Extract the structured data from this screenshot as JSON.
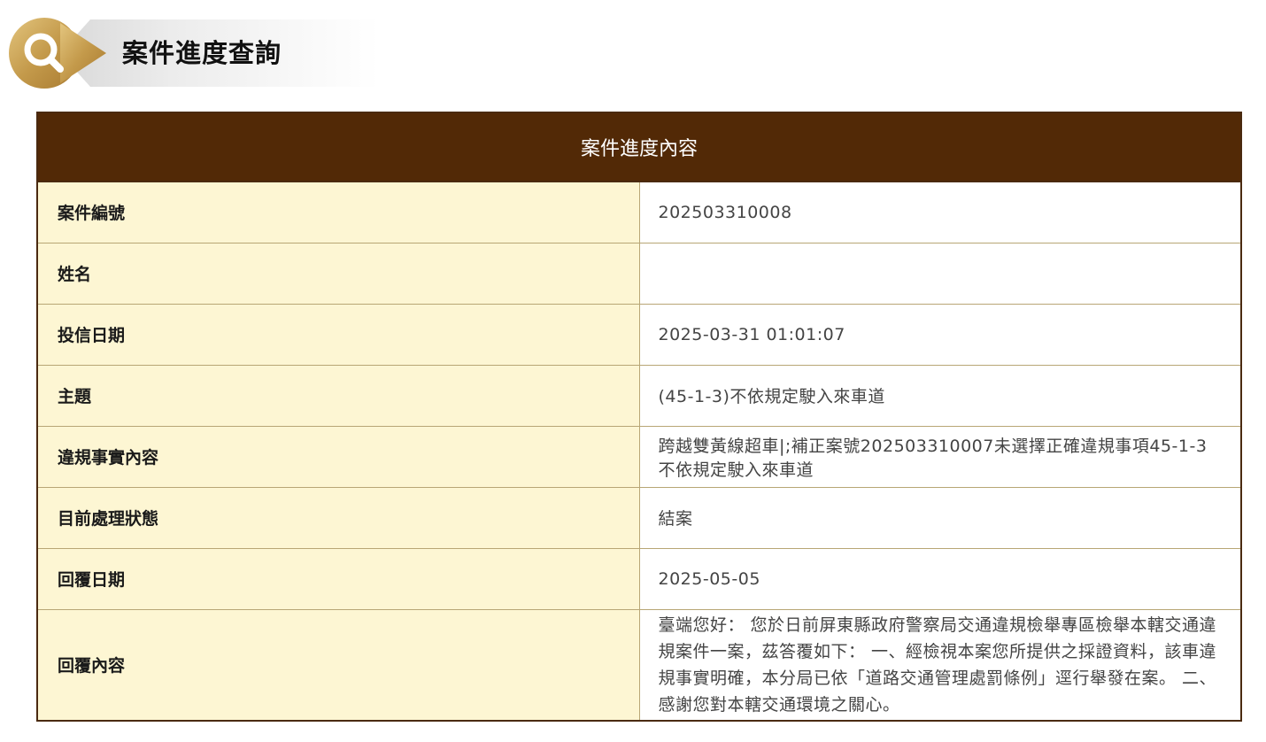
{
  "header": {
    "title": "案件進度查詢",
    "logo_icon": "search-magnifier-icon",
    "accent_color": "#c9a45a"
  },
  "table": {
    "heading": "案件進度內容",
    "heading_bg": "#522906",
    "label_bg": "#fdf6d3",
    "rows": [
      {
        "label": "案件編號",
        "value": "202503310008"
      },
      {
        "label": "姓名",
        "value": ""
      },
      {
        "label": "投信日期",
        "value": "2025-03-31 01:01:07"
      },
      {
        "label": "主題",
        "value": "(45-1-3)不依規定駛入來車道"
      },
      {
        "label": "違規事實內容",
        "value": "跨越雙黃線超車|;補正案號202503310007未選擇正確違規事項45-1-3不依規定駛入來車道"
      },
      {
        "label": "目前處理狀態",
        "value": "結案"
      },
      {
        "label": "回覆日期",
        "value": "2025-05-05"
      },
      {
        "label": "回覆內容",
        "value": "臺端您好： 您於日前屏東縣政府警察局交通違規檢舉專區檢舉本轄交通違規案件一案，茲答覆如下： 一、經檢視本案您所提供之採證資料，該車違規事實明確，本分局已依「道路交通管理處罰條例」逕行舉發在案。 二、感謝您對本轄交通環境之關心。"
      }
    ]
  }
}
